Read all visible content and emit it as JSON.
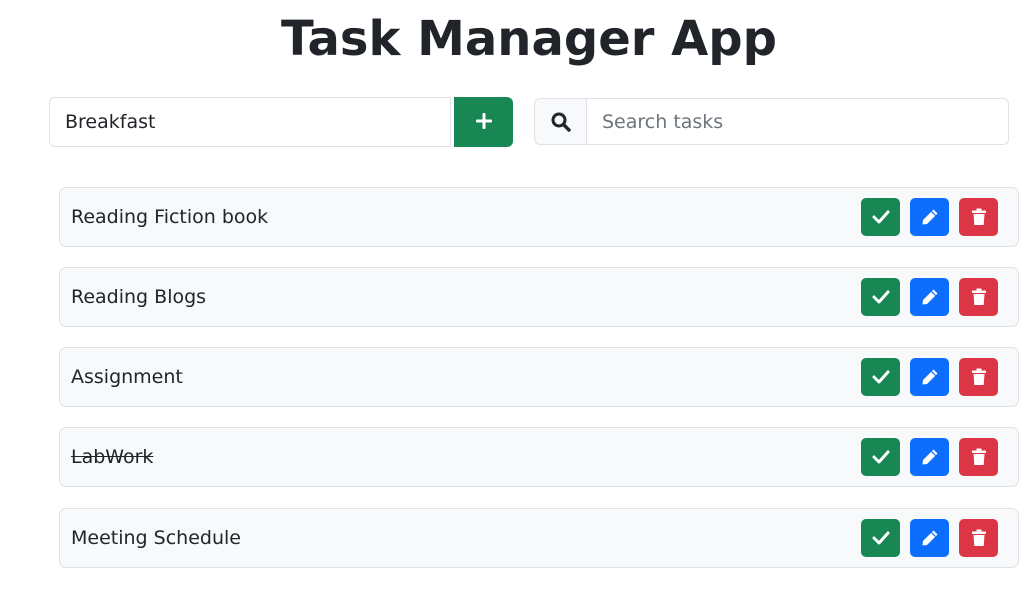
{
  "app": {
    "title": "Task Manager App"
  },
  "add_form": {
    "input_value": "Breakfast",
    "add_icon": "plus-icon"
  },
  "search": {
    "placeholder": "Search tasks",
    "value": "",
    "icon": "search-icon"
  },
  "tasks": [
    {
      "label": "Reading Fiction book",
      "completed": false
    },
    {
      "label": "Reading Blogs",
      "completed": false
    },
    {
      "label": "Assignment",
      "completed": false
    },
    {
      "label": "LabWork",
      "completed": true
    },
    {
      "label": "Meeting Schedule",
      "completed": false
    }
  ],
  "task_actions": {
    "complete_icon": "check-icon",
    "edit_icon": "pencil-icon",
    "delete_icon": "trash-icon"
  },
  "colors": {
    "success": "#198754",
    "primary": "#0d6efd",
    "danger": "#dc3545",
    "item_bg": "#f8f9fa",
    "border": "#dee2e6",
    "text": "#212529"
  }
}
